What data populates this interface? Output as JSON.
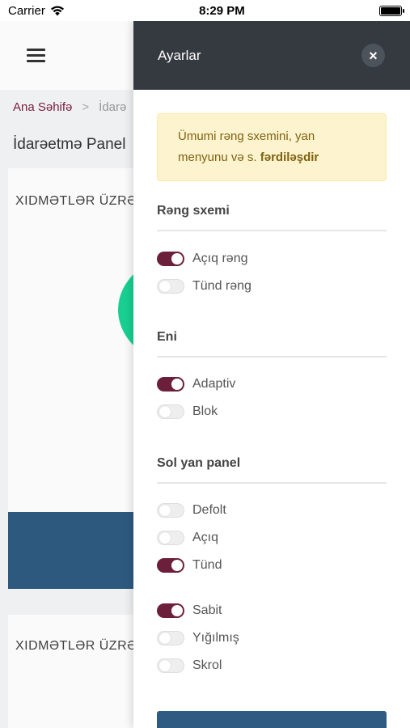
{
  "status_bar": {
    "carrier": "Carrier",
    "time": "8:29 PM"
  },
  "breadcrumb": {
    "home": "Ana Səhifə",
    "separator": ">",
    "current": "İdarə"
  },
  "page_title": "İdarəetmə Panel",
  "cards": [
    {
      "title": "XIDMƏTLƏR ÜZRƏ"
    },
    {
      "title": "XIDMƏTLƏR ÜZRƏ"
    }
  ],
  "settings": {
    "title": "Ayarlar",
    "close_icon": "×",
    "info_text": "Ümumi rəng sxemini, yan menyunu və s.",
    "info_strong": "fərdiləşdir",
    "sections": {
      "color_scheme": {
        "title": "Rəng sxemi",
        "options": [
          {
            "label": "Açıq rəng",
            "on": true
          },
          {
            "label": "Tünd rəng",
            "on": false
          }
        ]
      },
      "width": {
        "title": "Eni",
        "options": [
          {
            "label": "Adaptiv",
            "on": true
          },
          {
            "label": "Blok",
            "on": false
          }
        ]
      },
      "sidebar": {
        "title": "Sol yan panel",
        "theme_options": [
          {
            "label": "Defolt",
            "on": false
          },
          {
            "label": "Açıq",
            "on": false
          },
          {
            "label": "Tünd",
            "on": true
          }
        ],
        "layout_options": [
          {
            "label": "Sabit",
            "on": true
          },
          {
            "label": "Yığılmış",
            "on": false
          },
          {
            "label": "Skrol",
            "on": false
          }
        ]
      }
    }
  },
  "colors": {
    "header_dark": "#343a40",
    "accent_maroon": "#6b1f3a",
    "primary_blue": "#2f5b82",
    "chart_green": "#19d494",
    "info_bg": "#fdf3cf"
  },
  "icons": [
    "wifi-icon",
    "battery-icon",
    "hamburger-menu-icon",
    "close-icon"
  ]
}
